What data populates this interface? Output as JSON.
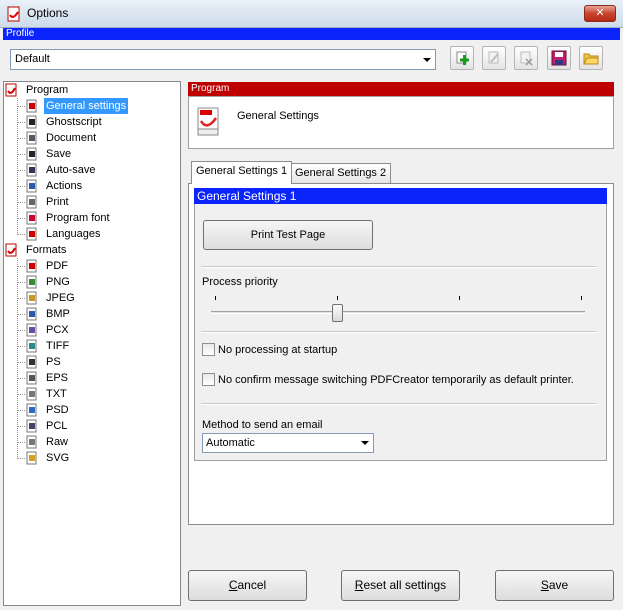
{
  "window": {
    "title": "Options",
    "close_glyph": "✕"
  },
  "profile": {
    "section_label": "Profile",
    "selected": "Default",
    "toolbar_icons": [
      "add-profile-icon",
      "rename-profile-icon",
      "delete-profile-icon",
      "save-profile-icon",
      "open-profile-icon"
    ]
  },
  "tree": {
    "program": {
      "label": "Program",
      "items": [
        {
          "label": "General settings",
          "icon": "general-settings-icon",
          "selected": true
        },
        {
          "label": "Ghostscript",
          "icon": "ghostscript-icon"
        },
        {
          "label": "Document",
          "icon": "document-icon"
        },
        {
          "label": "Save",
          "icon": "save-icon"
        },
        {
          "label": "Auto-save",
          "icon": "auto-save-icon"
        },
        {
          "label": "Actions",
          "icon": "actions-icon"
        },
        {
          "label": "Print",
          "icon": "printer-icon"
        },
        {
          "label": "Program font",
          "icon": "font-icon"
        },
        {
          "label": "Languages",
          "icon": "flag-icon"
        }
      ]
    },
    "formats": {
      "label": "Formats",
      "items": [
        {
          "label": "PDF",
          "icon": "pdf-file-icon"
        },
        {
          "label": "PNG",
          "icon": "png-file-icon"
        },
        {
          "label": "JPEG",
          "icon": "jpeg-file-icon"
        },
        {
          "label": "BMP",
          "icon": "bmp-file-icon"
        },
        {
          "label": "PCX",
          "icon": "pcx-file-icon"
        },
        {
          "label": "TIFF",
          "icon": "tiff-file-icon"
        },
        {
          "label": "PS",
          "icon": "ps-file-icon"
        },
        {
          "label": "EPS",
          "icon": "eps-file-icon"
        },
        {
          "label": "TXT",
          "icon": "txt-file-icon"
        },
        {
          "label": "PSD",
          "icon": "psd-file-icon"
        },
        {
          "label": "PCL",
          "icon": "pcl-file-icon"
        },
        {
          "label": "Raw",
          "icon": "raw-file-icon"
        },
        {
          "label": "SVG",
          "icon": "svg-file-icon"
        }
      ]
    }
  },
  "panel": {
    "header": "Program",
    "title": "General Settings",
    "tabs": [
      "General Settings 1",
      "General Settings 2"
    ],
    "active_tab": 0,
    "group_title": "General Settings 1",
    "test_button": "Print Test Page",
    "priority_label": "Process priority",
    "priority_level": 2,
    "priority_levels": 4,
    "chk_startup": "No processing at startup",
    "chk_confirm": "No confirm message switching PDFCreator temporarily as default printer.",
    "chk_startup_checked": false,
    "chk_confirm_checked": false,
    "email_label": "Method to send an email",
    "email_value": "Automatic"
  },
  "buttons": {
    "cancel_key": "C",
    "cancel_rest": "ancel",
    "reset_key": "R",
    "reset_rest": "eset all settings",
    "save_key": "S",
    "save_rest": "ave"
  },
  "colors": {
    "profile_bar": "#0b24fb",
    "program_header": "#be0000",
    "selection": "#3399ff"
  }
}
